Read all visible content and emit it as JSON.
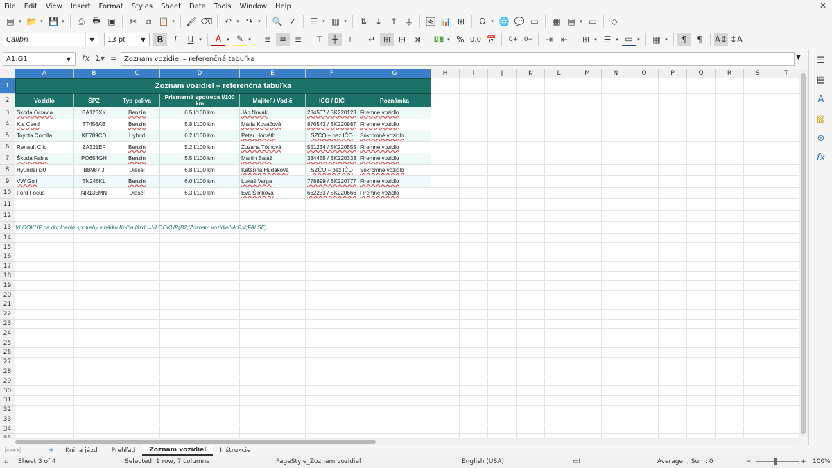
{
  "menu": [
    "File",
    "Edit",
    "View",
    "Insert",
    "Format",
    "Styles",
    "Sheet",
    "Data",
    "Tools",
    "Window",
    "Help"
  ],
  "font": {
    "name": "Calibri",
    "size": "13 pt"
  },
  "namebox": "A1:G1",
  "formula": "Zoznam vozidiel – referenčná tabuľka",
  "columns": [
    "A",
    "B",
    "C",
    "D",
    "E",
    "F",
    "G",
    "H",
    "I",
    "J",
    "K",
    "L",
    "M",
    "N",
    "O",
    "P",
    "Q",
    "R",
    "S",
    "T"
  ],
  "rows": [
    "1",
    "2",
    "3",
    "4",
    "5",
    "6",
    "7",
    "8",
    "9",
    "10",
    "11",
    "12",
    "13",
    "14",
    "15",
    "16",
    "17",
    "18",
    "19",
    "20",
    "21",
    "22",
    "23",
    "24",
    "25",
    "26",
    "27",
    "28",
    "29",
    "30",
    "31",
    "32",
    "33",
    "34",
    "35"
  ],
  "sheet": {
    "title": "Zoznam vozidiel – referenčná tabuľka",
    "headers": [
      "Vozidlo",
      "ŠPZ",
      "Typ paliva",
      "Priemerná spotreba l/100 km",
      "Majiteľ / Vodič",
      "IČO / DIČ",
      "Poznámka"
    ],
    "data": [
      [
        "Škoda Octavia",
        "BA123XY",
        "Benzín",
        "6.5 l/100 km",
        "Ján Novák",
        "234567 / SK220123",
        "Firemné vozidlo"
      ],
      [
        "Kia Ceed",
        "TT456AB",
        "Benzín",
        "5.8 l/100 km",
        "Mária Kováčová",
        "876543 / SK220987",
        "Firemné vozidlo"
      ],
      [
        "Toyota Corolla",
        "KE789CD",
        "Hybrid",
        "6.2 l/100 km",
        "Peter Horváth",
        "SZČO – bez IČO",
        "Súkromné vozidlo"
      ],
      [
        "Renault Clio",
        "ZA321EF",
        "Benzín",
        "5.2 l/100 km",
        "Zuzana Tóthová",
        "551234 / SK220555",
        "Firemné vozidlo"
      ],
      [
        "Škoda Fabia",
        "PO654GH",
        "Benzín",
        "5.5 l/100 km",
        "Martin Baláž",
        "334455 / SK220333",
        "Firemné vozidlo"
      ],
      [
        "Hyundai i30",
        "BB987IJ",
        "Diesel",
        "6.8 l/100 km",
        "Katarína Hudáková",
        "SZČO – bez IČO",
        "Súkromné vozidlo"
      ],
      [
        "VW Golf",
        "TN246KL",
        "Benzín",
        "6.0 l/100 km",
        "Lukáš Varga",
        "778899 / SK220777",
        "Firemné vozidlo"
      ],
      [
        "Ford Focus",
        "NR135MN",
        "Diesel",
        "6.3 l/100 km",
        "Eva Šimková",
        "662233 / SK220666",
        "Firemné vozidlo"
      ]
    ],
    "note": "VLOOKUP na doplnenie spotreby v hárku Kniha jázd:  =VLOOKUP(B2;'Zoznam vozidiel'!A:D;4;FALSE)"
  },
  "tabs": [
    "Kniha jázd",
    "Prehľad",
    "Zoznam vozidiel",
    "Inštrukcie"
  ],
  "active_tab": "Zoznam vozidiel",
  "status": {
    "sheet": "Sheet 3 of 4",
    "selection": "Selected: 1 row, 7 columns",
    "pagestyle": "PageStyle_Zoznam vozidiel",
    "language": "English (USA)",
    "sum": "Average: ; Sum: 0",
    "zoom": "100%"
  },
  "colors": {
    "header_bg": "#1d7267",
    "selection": "#3a7fc8"
  }
}
